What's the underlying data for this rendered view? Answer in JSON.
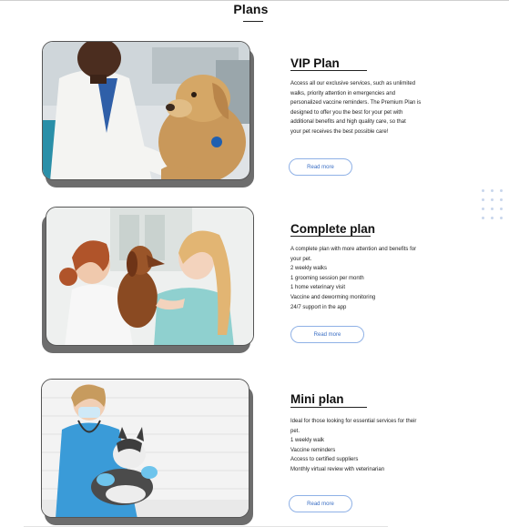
{
  "section": {
    "title": "Plans"
  },
  "plans": [
    {
      "title": "VIP Plan",
      "description_lines": [
        "Access all our exclusive services, such as unlimited",
        "walks, priority attention in emergencies and",
        "personalized vaccine reminders. The Premium Plan is",
        "designed to offer you the best for your pet with",
        "additional benefits and high quality care, so that",
        "your pet receives the best possible care!"
      ],
      "button_label": "Read more"
    },
    {
      "title": "Complete plan",
      "description_lines": [
        "A complete plan with more attention and benefits for",
        "your pet.",
        "2 weekly walks",
        "1 grooming session per month",
        "1 home veterinary visit",
        "Vaccine and deworming monitoring",
        "24/7 support in the app"
      ],
      "button_label": "Read more"
    },
    {
      "title": "Mini plan",
      "description_lines": [
        "Ideal for those looking for essential services for their",
        "pet.",
        "1 weekly walk",
        "Vaccine reminders",
        "Access to certified suppliers",
        "Monthly virtual review with veterinarian"
      ],
      "button_label": "Read more"
    }
  ],
  "colors": {
    "accent": "#3b6fc4",
    "button_border": "#8fb1e6",
    "shadow": "#6d6d6d",
    "dots": "#c8d6ec"
  }
}
